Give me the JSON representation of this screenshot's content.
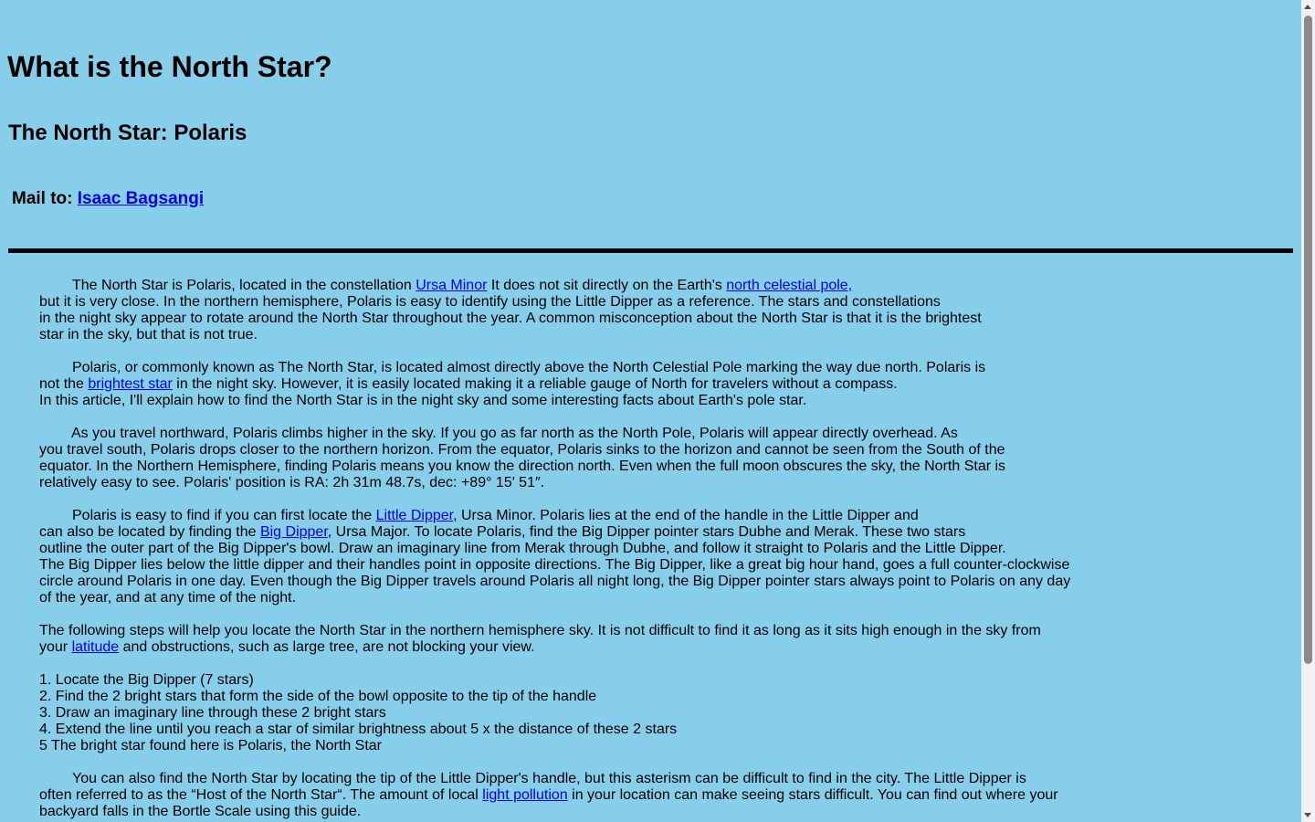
{
  "header": {
    "title": "What is the North Star?",
    "subtitle": "The North Star: Polaris",
    "mail_label": "Mail to:",
    "mail_link": "Isaac Bagsangi"
  },
  "paragraphs": {
    "p1": {
      "l1_a": "The North Star is Polaris, located in the constellation ",
      "l1_link1": "Ursa Minor",
      "l1_b": " It does not sit directly on the Earth's ",
      "l1_link2": "north celestial pole,",
      "l2": "but it is very close. In the northern hemisphere, Polaris is easy to identify using the Little Dipper as a reference. The stars and constellations",
      "l3": "in the night sky appear to rotate around the North Star throughout the year. A common misconception about the North Star is that it is the brightest",
      "l4": "star in the sky, but that is not true."
    },
    "p2": {
      "l1": "Polaris, or commonly known as The North Star, is located almost directly above the North Celestial Pole marking the way due north. Polaris is",
      "l2_a": "not the ",
      "l2_link": "brightest star",
      "l2_b": " in the night sky. However, it is easily located making it a reliable gauge of North for travelers without a compass.",
      "l3": "In this article, I'll explain how to find the North Star is in the night sky and some interesting facts about Earth's pole star."
    },
    "p3": {
      "l1": "As you travel northward, Polaris climbs higher in the sky. If you go as far north as the North Pole, Polaris will appear directly overhead. As",
      "l2": "you travel south, Polaris drops closer to the northern horizon. From the equator, Polaris sinks to the horizon and cannot be seen from the South of the",
      "l3": "equator. In the Northern Hemisphere, finding Polaris means you know the direction north. Even when the full moon obscures the sky, the North Star is",
      "l4": "relatively easy to see. Polaris' position is RA: 2h 31m 48.7s, dec: +89° 15′ 51″."
    },
    "p4": {
      "l1_a": "Polaris is easy to find if you can first locate the ",
      "l1_link": "Little Dipper",
      "l1_b": ", Ursa Minor. Polaris lies at the end of the handle in the Little Dipper and",
      "l2_a": "can also be located by finding the ",
      "l2_link": "Big Dipper",
      "l2_b": ", Ursa Major. To locate Polaris, find the Big Dipper pointer stars Dubhe and Merak. These two stars",
      "l3": "outline the outer part of the Big Dipper's bowl. Draw an imaginary line from Merak through Dubhe, and follow it straight to Polaris and the Little Dipper.",
      "l4": "The Big Dipper lies below the little dipper and their handles point in opposite directions. The Big Dipper, like a great big hour hand, goes a full counter-clockwise",
      "l5": "circle around Polaris in one day. Even though the Big Dipper travels around Polaris all night long, the Big Dipper pointer stars always point to Polaris on any day",
      "l6": "of the year, and at any time of the night."
    },
    "p5": {
      "l1": "The following steps will help you locate the North Star in the northern hemisphere sky. It is not difficult to find it as long as it sits high enough in the sky from",
      "l2_a": "your ",
      "l2_link": "latitude",
      "l2_b": " and obstructions, such as large tree, are not blocking your view."
    },
    "steps": [
      "1. Locate the Big Dipper (7 stars)",
      "2. Find the 2 bright stars that form the side of the bowl opposite to the tip of the handle",
      "3. Draw an imaginary line through these 2 bright stars",
      "4. Extend the line until you reach a star of similar brightness about 5 x the distance of these 2 stars",
      "5 The bright star found here is Polaris, the North Star"
    ],
    "p6": {
      "l1": "You can also find the North Star by locating the tip of the Little Dipper's handle, but this asterism can be difficult to find in the city. The Little Dipper is",
      "l2_a": "often referred to as the “Host of the North Star“. The amount of local ",
      "l2_link": "light pollution",
      "l2_b": " in your location can make seeing stars difficult. You can find out where your",
      "l3": "backyard falls in the Bortle Scale using this guide."
    }
  }
}
